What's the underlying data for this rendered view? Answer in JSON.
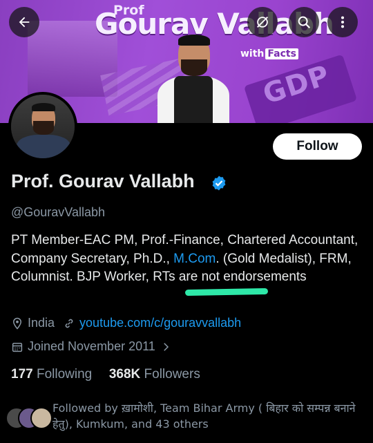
{
  "banner": {
    "prof": "Prof",
    "name": "Gourav Vallabh",
    "with": "with",
    "facts": "Facts",
    "gdp": "GDP"
  },
  "topbar": {
    "back_icon": "back-arrow-icon",
    "icons": [
      "no-filter-icon",
      "search-icon",
      "more-vertical-icon"
    ]
  },
  "profile": {
    "follow_label": "Follow",
    "display_name": "Prof. Gourav Vallabh",
    "handle": "@GouravVallabh",
    "bio": {
      "part1": "PT Member-EAC PM, Prof.-Finance, Chartered Accountant, Company Secretary, Ph.D., ",
      "link": "M.Com",
      "part2": ". (Gold Medalist), FRM, Columnist. BJP Worker, RTs are not endorsements"
    },
    "location": "India",
    "website": "youtube.com/c/gouravvallabh",
    "joined": "Joined November 2011",
    "following_count": "177",
    "following_label": "Following",
    "followers_count": "368K",
    "followers_label": "Followers",
    "followed_by": "Followed by ख़ामोशी, Team Bihar Army ( बिहार को सम्पन्न बनाने हेतु), Kumkum, and 43 others"
  },
  "colors": {
    "accent": "#1d9bf0",
    "banner": "#9a44cf",
    "highlight": "#2ee8a8"
  }
}
